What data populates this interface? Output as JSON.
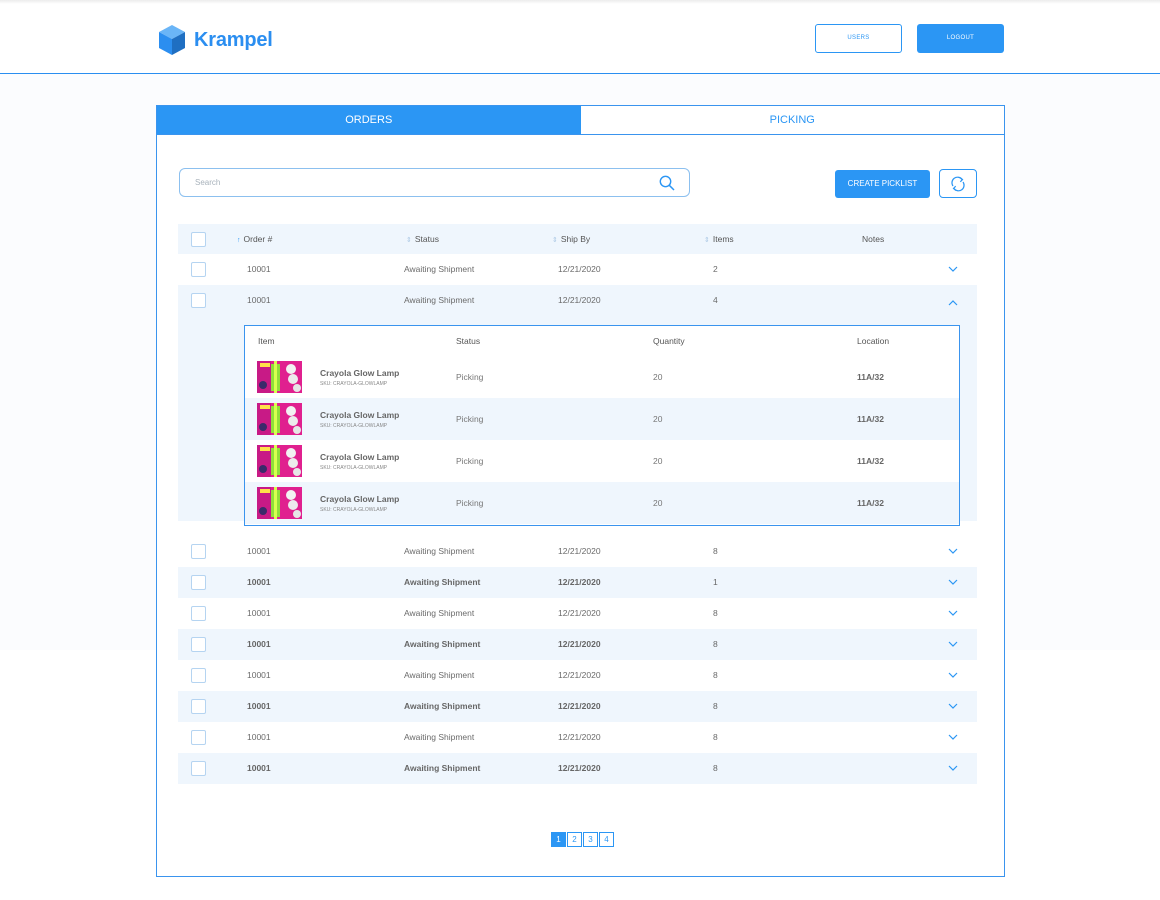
{
  "app": {
    "name": "Krampel"
  },
  "header": {
    "users_label": "USERS",
    "logout_label": "LOGOUT"
  },
  "tabs": [
    {
      "label": "ORDERS",
      "active": true
    },
    {
      "label": "PICKING",
      "active": false
    }
  ],
  "search": {
    "placeholder": "Search"
  },
  "actions": {
    "create_picklist_label": "CREATE PICKLIST"
  },
  "table": {
    "columns": {
      "order": "Order #",
      "status": "Status",
      "ship_by": "Ship By",
      "items": "Items",
      "notes": "Notes"
    },
    "rows": [
      {
        "order": "10001",
        "status": "Awaiting Shipment",
        "ship_by": "12/21/2020",
        "items": "2",
        "notes": "",
        "expanded": false
      },
      {
        "order": "10001",
        "status": "Awaiting Shipment",
        "ship_by": "12/21/2020",
        "items": "4",
        "notes": "",
        "expanded": true
      },
      {
        "order": "10001",
        "status": "Awaiting Shipment",
        "ship_by": "12/21/2020",
        "items": "8",
        "notes": "",
        "expanded": false
      },
      {
        "order": "10001",
        "status": "Awaiting Shipment",
        "ship_by": "12/21/2020",
        "items": "1",
        "notes": "",
        "expanded": false
      },
      {
        "order": "10001",
        "status": "Awaiting Shipment",
        "ship_by": "12/21/2020",
        "items": "8",
        "notes": "",
        "expanded": false
      },
      {
        "order": "10001",
        "status": "Awaiting Shipment",
        "ship_by": "12/21/2020",
        "items": "8",
        "notes": "",
        "expanded": false
      },
      {
        "order": "10001",
        "status": "Awaiting Shipment",
        "ship_by": "12/21/2020",
        "items": "8",
        "notes": "",
        "expanded": false
      },
      {
        "order": "10001",
        "status": "Awaiting Shipment",
        "ship_by": "12/21/2020",
        "items": "8",
        "notes": "",
        "expanded": false
      },
      {
        "order": "10001",
        "status": "Awaiting Shipment",
        "ship_by": "12/21/2020",
        "items": "8",
        "notes": "",
        "expanded": false
      },
      {
        "order": "10001",
        "status": "Awaiting Shipment",
        "ship_by": "12/21/2020",
        "items": "8",
        "notes": "",
        "expanded": false
      }
    ]
  },
  "detail": {
    "columns": {
      "item": "Item",
      "status": "Status",
      "quantity": "Quantity",
      "location": "Location"
    },
    "rows": [
      {
        "name": "Crayola Glow Lamp",
        "sku": "SKU: CRAYOLA-GLOWLAMP",
        "status": "Picking",
        "quantity": "20",
        "location": "11A/32"
      },
      {
        "name": "Crayola Glow Lamp",
        "sku": "SKU: CRAYOLA-GLOWLAMP",
        "status": "Picking",
        "quantity": "20",
        "location": "11A/32"
      },
      {
        "name": "Crayola Glow Lamp",
        "sku": "SKU: CRAYOLA-GLOWLAMP",
        "status": "Picking",
        "quantity": "20",
        "location": "11A/32"
      },
      {
        "name": "Crayola Glow Lamp",
        "sku": "SKU: CRAYOLA-GLOWLAMP",
        "status": "Picking",
        "quantity": "20",
        "location": "11A/32"
      }
    ]
  },
  "pagination": {
    "pages": [
      "1",
      "2",
      "3",
      "4"
    ],
    "current": "1"
  },
  "colors": {
    "accent": "#2b96f4",
    "row_alt": "#eff6fd",
    "border": "#3a94ee"
  },
  "icons": {
    "logo": "cube-icon",
    "search": "search-icon",
    "refresh": "refresh-icon",
    "expand": "chevron-down-icon",
    "collapse": "chevron-up-icon",
    "sort_asc": "sort-up-icon",
    "sort": "sort-icon"
  }
}
